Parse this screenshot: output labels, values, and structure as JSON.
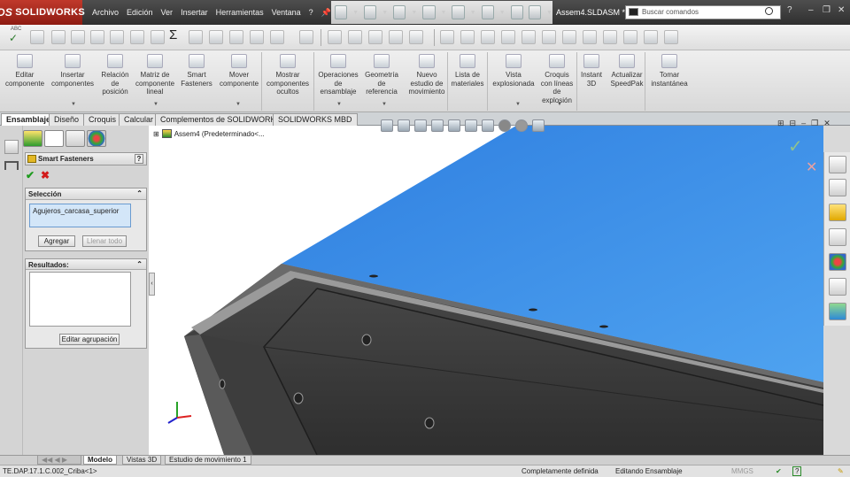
{
  "app": {
    "brand": "SOLIDWORKS",
    "doc_title": "Assem4.SLDASM *"
  },
  "menu": [
    "Archivo",
    "Edición",
    "Ver",
    "Insertar",
    "Herramientas",
    "Ventana",
    "?"
  ],
  "search": {
    "placeholder": "Buscar comandos"
  },
  "window_controls": {
    "help": "?",
    "minimize": "–",
    "restore": "❐",
    "close": "✕"
  },
  "toolbar2_letter": "ABC",
  "command_manager": [
    {
      "label": "Editar componente",
      "icon": "edit-component-icon"
    },
    {
      "label": "Insertar componentes",
      "icon": "insert-components-icon"
    },
    {
      "label": "Relación de posición",
      "icon": "mate-icon"
    },
    {
      "label": "Matriz de componente lineal",
      "icon": "linear-pattern-icon"
    },
    {
      "label": "Smart Fasteners",
      "icon": "smart-fasteners-icon"
    },
    {
      "label": "Mover componente",
      "icon": "move-component-icon"
    },
    {
      "label": "Mostrar componentes ocultos",
      "icon": "show-hidden-icon"
    },
    {
      "label": "Operaciones de ensamblaje",
      "icon": "assembly-features-icon"
    },
    {
      "label": "Geometría de referencia",
      "icon": "reference-geometry-icon"
    },
    {
      "label": "Nuevo estudio de movimiento",
      "icon": "motion-study-icon"
    },
    {
      "label": "Lista de materiales",
      "icon": "bom-icon"
    },
    {
      "label": "Vista explosionada",
      "icon": "exploded-view-icon"
    },
    {
      "label": "Croquis con líneas de explosión",
      "icon": "explode-line-sketch-icon"
    },
    {
      "label": "Instant 3D",
      "icon": "instant-3d-icon"
    },
    {
      "label": "Actualizar SpeedPak",
      "icon": "speedpak-icon"
    },
    {
      "label": "Tomar instantánea",
      "icon": "snapshot-icon"
    }
  ],
  "tabs": [
    "Ensamblaje",
    "Diseño",
    "Croquis",
    "Calcular",
    "Complementos de SOLIDWORKS",
    "SOLIDWORKS MBD"
  ],
  "active_tab": "Ensamblaje",
  "feature_tree": {
    "root": "Assem4  (Predeterminado<..."
  },
  "property_manager": {
    "title": "Smart Fasteners",
    "help": "?",
    "ok_symbol": "✔",
    "cancel_symbol": "✖",
    "selection": {
      "header": "Selección",
      "item": "Agujeros_carcasa_superior",
      "add_button": "Agregar",
      "fill_all_button": "Llenar todo"
    },
    "results": {
      "header": "Resultados:",
      "edit_group_button": "Editar agrupación"
    }
  },
  "bottom_tabs": [
    "Modelo",
    "Vistas 3D",
    "Estudio de movimiento 1"
  ],
  "active_bottom_tab": "Modelo",
  "status": {
    "left": "TE.DAP.17.1.C.002_Criba<1>",
    "definition": "Completamente definida",
    "mode": "Editando Ensamblaje",
    "units": "MMGS",
    "help": "?"
  },
  "colors": {
    "brand_red": "#c0392b",
    "sky_blue": "#3b8de6",
    "model_gray": "#3a3a3a",
    "ok_green": "#1e9b1e",
    "cancel_red": "#d21a1a"
  }
}
